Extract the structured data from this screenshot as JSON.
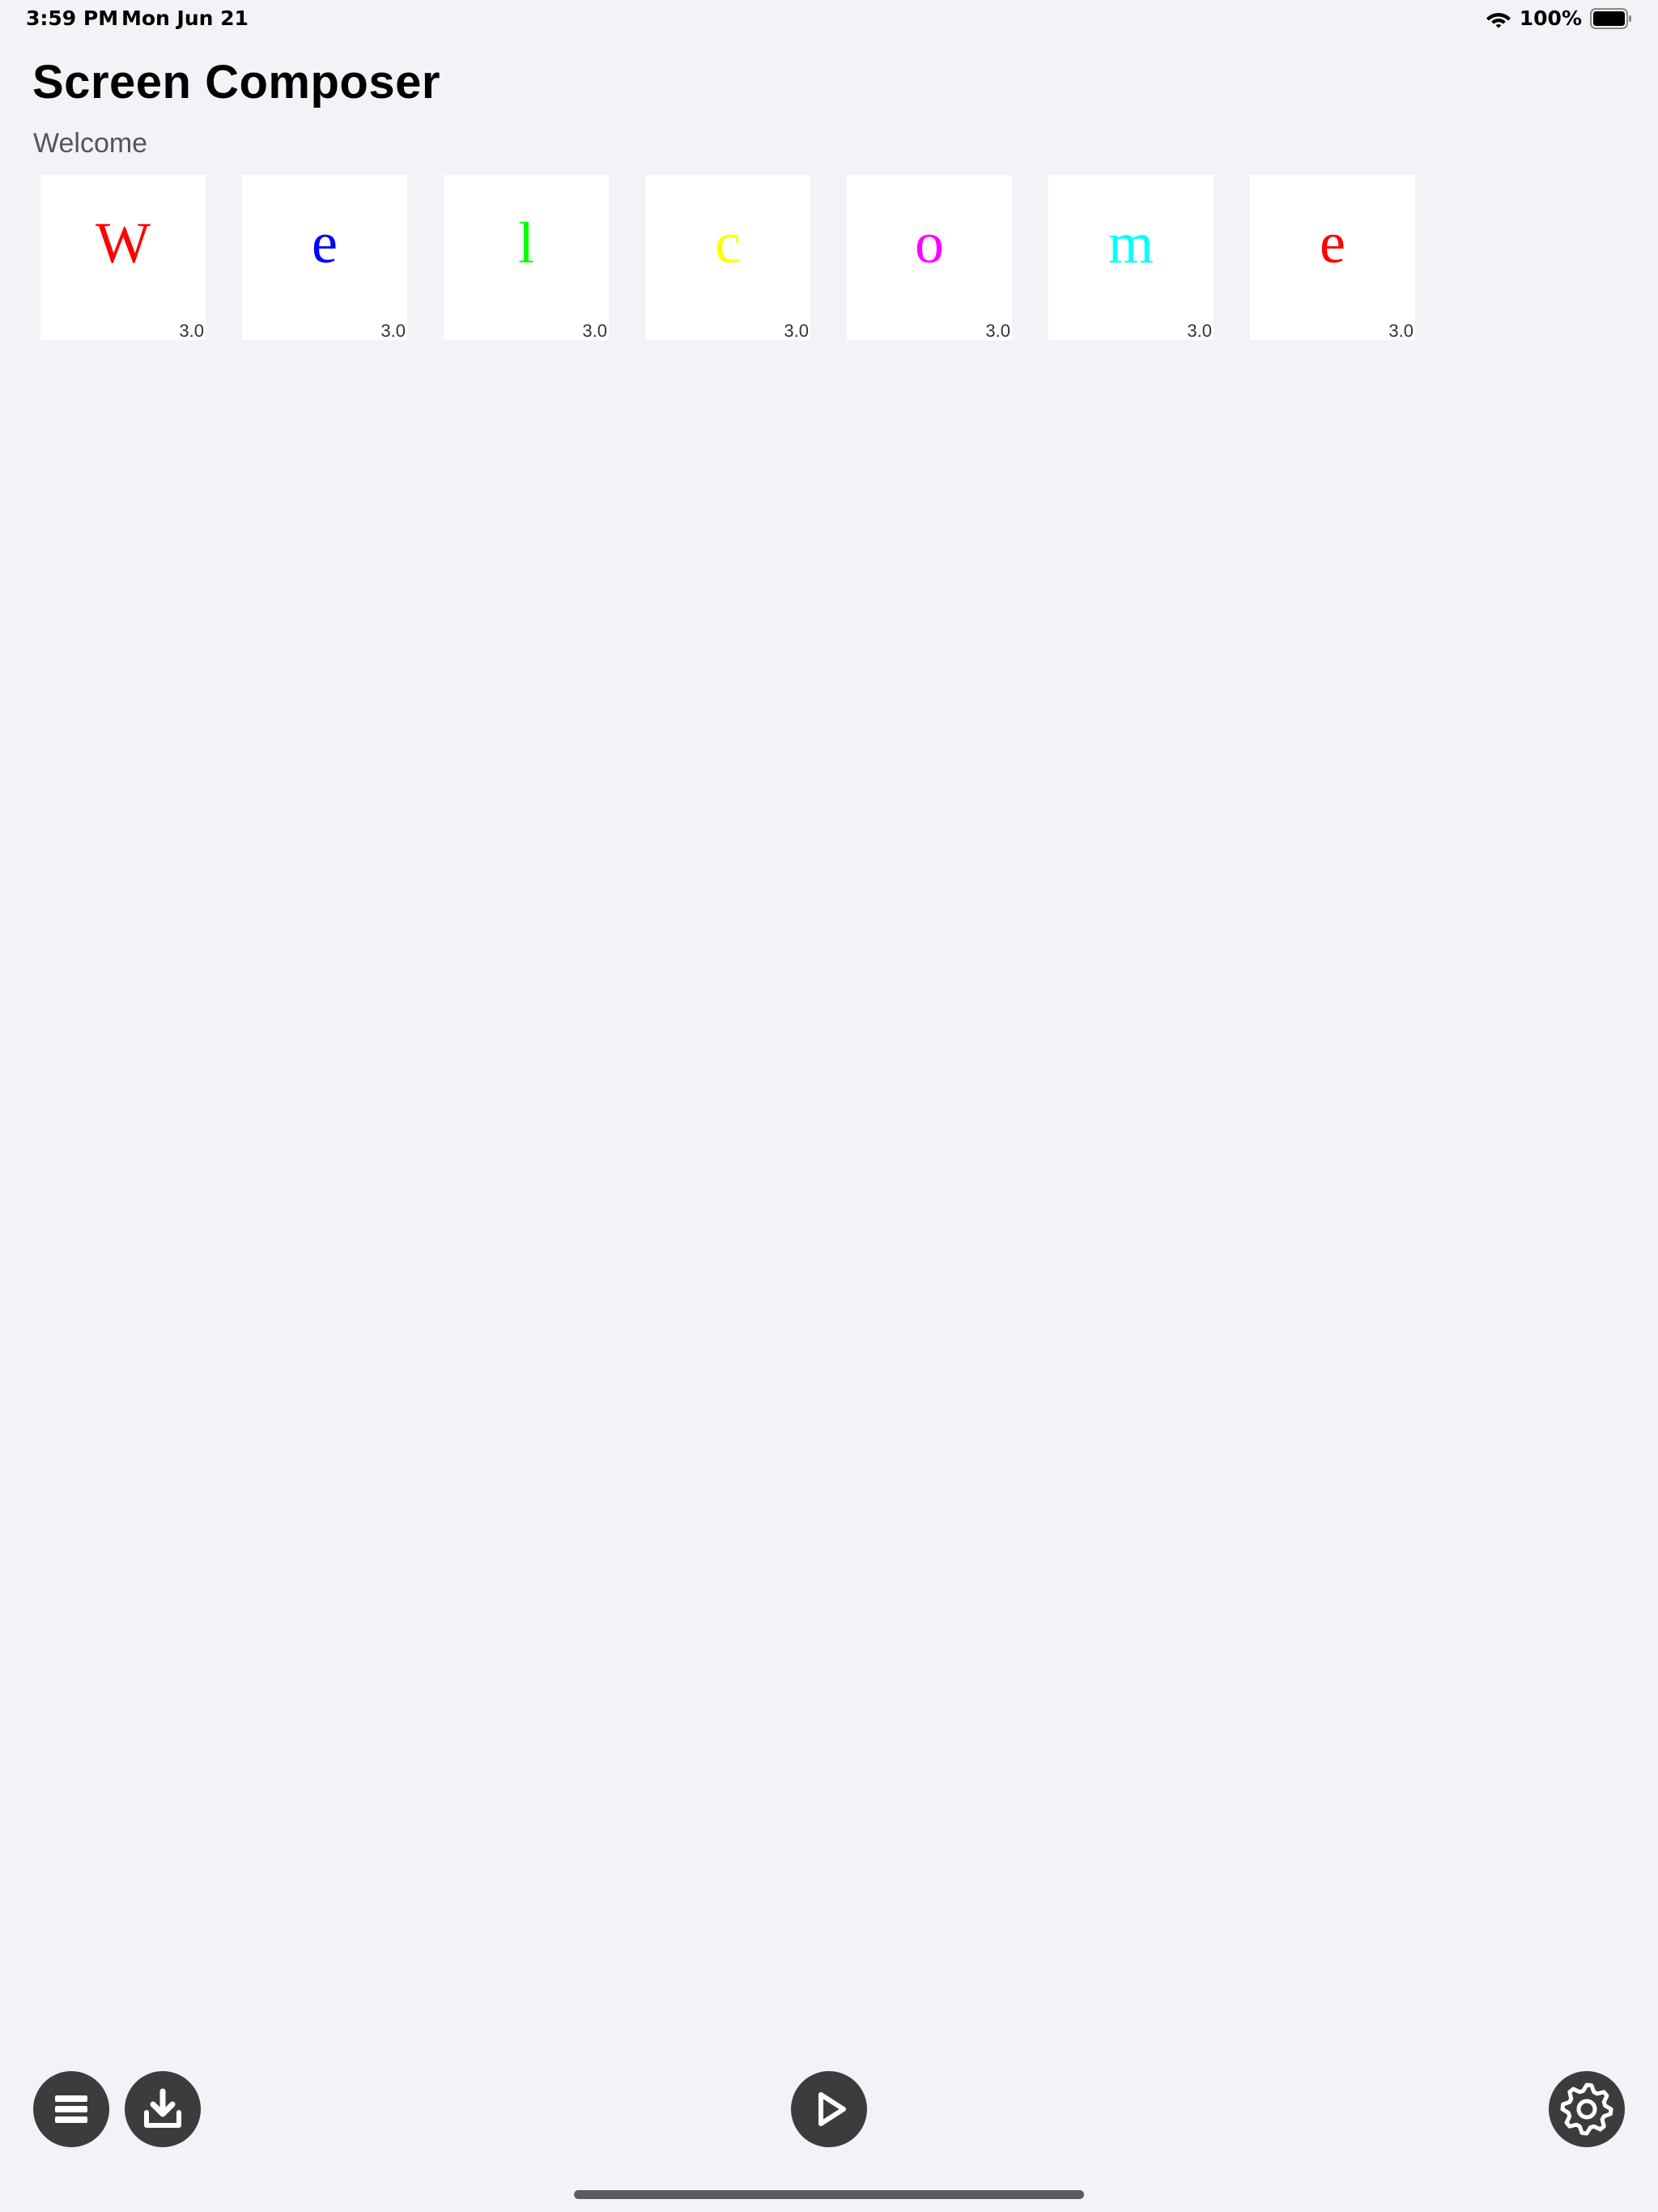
{
  "status_bar": {
    "time": "3:59 PM",
    "date": "Mon Jun 21",
    "battery_percent": "100%",
    "battery_level": 1.0,
    "icons": [
      "wifi-icon",
      "battery-icon"
    ]
  },
  "header": {
    "title": "Screen Composer",
    "section_label": "Welcome"
  },
  "tiles": [
    {
      "letter": "W",
      "duration": "3.0",
      "color": "#ff0000"
    },
    {
      "letter": "e",
      "duration": "3.0",
      "color": "#0000ff"
    },
    {
      "letter": "l",
      "duration": "3.0",
      "color": "#00ff00"
    },
    {
      "letter": "c",
      "duration": "3.0",
      "color": "#ffff00"
    },
    {
      "letter": "o",
      "duration": "3.0",
      "color": "#ff00ff"
    },
    {
      "letter": "m",
      "duration": "3.0",
      "color": "#00ffff"
    },
    {
      "letter": "e",
      "duration": "3.0",
      "color": "#ff0000"
    }
  ],
  "toolbar": {
    "buttons": [
      {
        "icon": "list-icon"
      },
      {
        "icon": "download-icon"
      },
      {
        "icon": "play-icon"
      },
      {
        "icon": "gear-icon"
      }
    ],
    "button_color": "#3c3c3e"
  },
  "colors": {
    "background": "#f2f2f7",
    "tile_background": "#ffffff"
  }
}
